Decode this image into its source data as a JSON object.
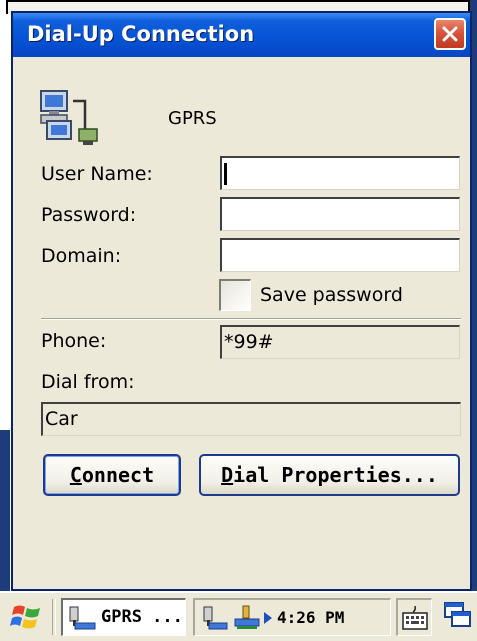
{
  "window": {
    "title": "Dial-Up Connection",
    "close_icon": "close-icon"
  },
  "connection": {
    "name": "GPRS",
    "icon": "network-connection-icon"
  },
  "form": {
    "user_name_label": "User Name:",
    "user_name_value": "",
    "password_label": "Password:",
    "password_value": "",
    "domain_label": "Domain:",
    "domain_value": "",
    "save_password_label": "Save password",
    "save_password_checked": false,
    "phone_label": "Phone:",
    "phone_value": "*99#",
    "dial_from_label": "Dial from:",
    "dial_from_value": "Car"
  },
  "buttons": {
    "connect_hotkey": "C",
    "connect_rest": "onnect",
    "dial_properties_hotkey": "D",
    "dial_properties_rest": "ial Properties..."
  },
  "taskbar": {
    "start_icon": "windows-flag-icon",
    "task_label": "GPRS ...",
    "clock": "4:26 PM",
    "keyboard_icon": "keyboard-icon",
    "desktop_icon": "show-desktop-icon"
  },
  "colors": {
    "title_bar": "#0553d6",
    "close_button": "#d8533a",
    "dialog_background": "#ece9d8",
    "button_border": "#1c3b8c"
  }
}
